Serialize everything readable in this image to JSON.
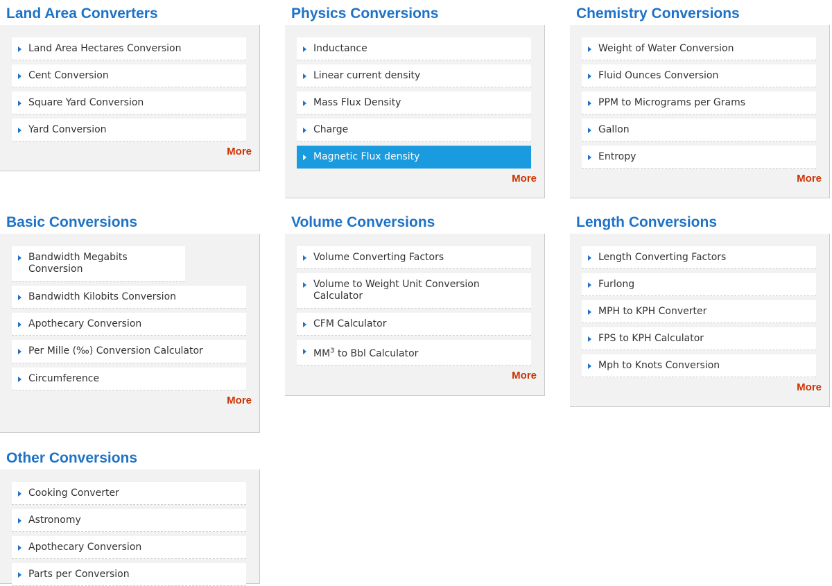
{
  "sections": {
    "land_area": {
      "title": "Land Area Converters",
      "items": [
        "Land Area Hectares Conversion",
        "Cent Conversion",
        "Square Yard Conversion",
        "Yard Conversion"
      ],
      "more": "More"
    },
    "physics": {
      "title": "Physics Conversions",
      "items": [
        "Inductance",
        "Linear current density",
        "Mass Flux Density",
        "Charge",
        "Magnetic Flux density"
      ],
      "more": "More"
    },
    "chemistry": {
      "title": "Chemistry Conversions",
      "items": [
        "Weight of Water Conversion",
        "Fluid Ounces Conversion",
        "PPM to Micrograms per Grams",
        "Gallon",
        "Entropy"
      ],
      "more": "More"
    },
    "basic": {
      "title": "Basic Conversions",
      "items": [
        "Bandwidth Megabits Conversion",
        "Bandwidth Kilobits Conversion",
        "Apothecary Conversion",
        "Per Mille (‰) Conversion Calculator",
        "Circumference"
      ],
      "more": "More"
    },
    "volume": {
      "title": "Volume Conversions",
      "items": [
        "Volume Converting Factors",
        "Volume to Weight Unit Conversion Calculator",
        "CFM Calculator"
      ],
      "mm3_prefix": "MM",
      "mm3_sup": "3",
      "mm3_suffix": " to Bbl Calculator",
      "more": "More"
    },
    "length": {
      "title": "Length Conversions",
      "items": [
        "Length Converting Factors",
        "Furlong",
        "MPH to KPH Converter",
        "FPS to KPH Calculator",
        "Mph to Knots Conversion"
      ],
      "more": "More"
    },
    "other": {
      "title": "Other Conversions",
      "items": [
        "Cooking Converter",
        "Astronomy",
        "Apothecary Conversion",
        "Parts per Conversion"
      ]
    }
  },
  "colors": {
    "title": "#1e72c7",
    "more": "#cc3300",
    "active_bg": "#1a9be0",
    "panel_bg": "#f2f2f2"
  },
  "icons": {
    "bullet": "triangle-right-icon"
  }
}
